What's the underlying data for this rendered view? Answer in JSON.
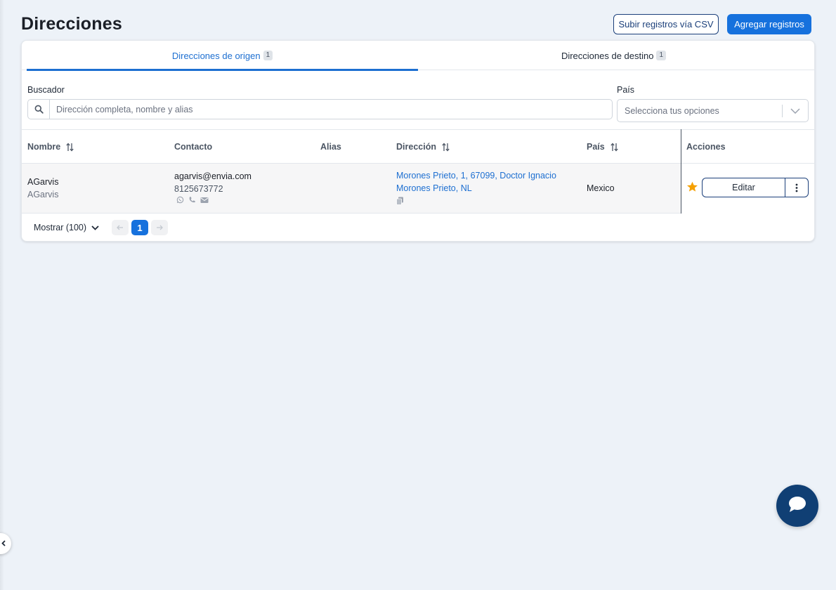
{
  "page": {
    "title": "Direcciones",
    "upload_csv_label": "Subir registros vía CSV",
    "add_records_label": "Agregar registros"
  },
  "tabs": [
    {
      "label": "Direcciones de origen",
      "count": "1",
      "active": true
    },
    {
      "label": "Direcciones de destino",
      "count": "1",
      "active": false
    }
  ],
  "filters": {
    "search_label": "Buscador",
    "search_placeholder": "Dirección completa, nombre y alias",
    "country_label": "País",
    "country_placeholder": "Selecciona tus opciones"
  },
  "table": {
    "columns": [
      "Nombre",
      "Contacto",
      "Alias",
      "Dirección",
      "País",
      "Acciones"
    ],
    "rows": [
      {
        "name": "AGarvis",
        "company": "AGarvis",
        "email": "agarvis@envia.com",
        "phone": "8125673772",
        "alias": "",
        "address": "Morones Prieto, 1, 67099, Doctor Ignacio Morones Prieto, NL",
        "country": "Mexico",
        "favorite": true,
        "edit_label": "Editar"
      }
    ]
  },
  "pagination": {
    "show_label": "Mostrar (100)",
    "current_page": "1"
  },
  "colors": {
    "primary": "#1671dd",
    "navy": "#1b3f7a",
    "star": "#f5a000",
    "chat": "#103f74"
  },
  "icons": [
    "search-icon",
    "chevron-down-icon",
    "sort-icon",
    "whatsapp-icon",
    "phone-icon",
    "mail-icon",
    "copy-icon",
    "star-icon",
    "more-vertical-icon",
    "arrow-left-icon",
    "arrow-right-icon",
    "chat-icon",
    "chevron-left-icon"
  ]
}
